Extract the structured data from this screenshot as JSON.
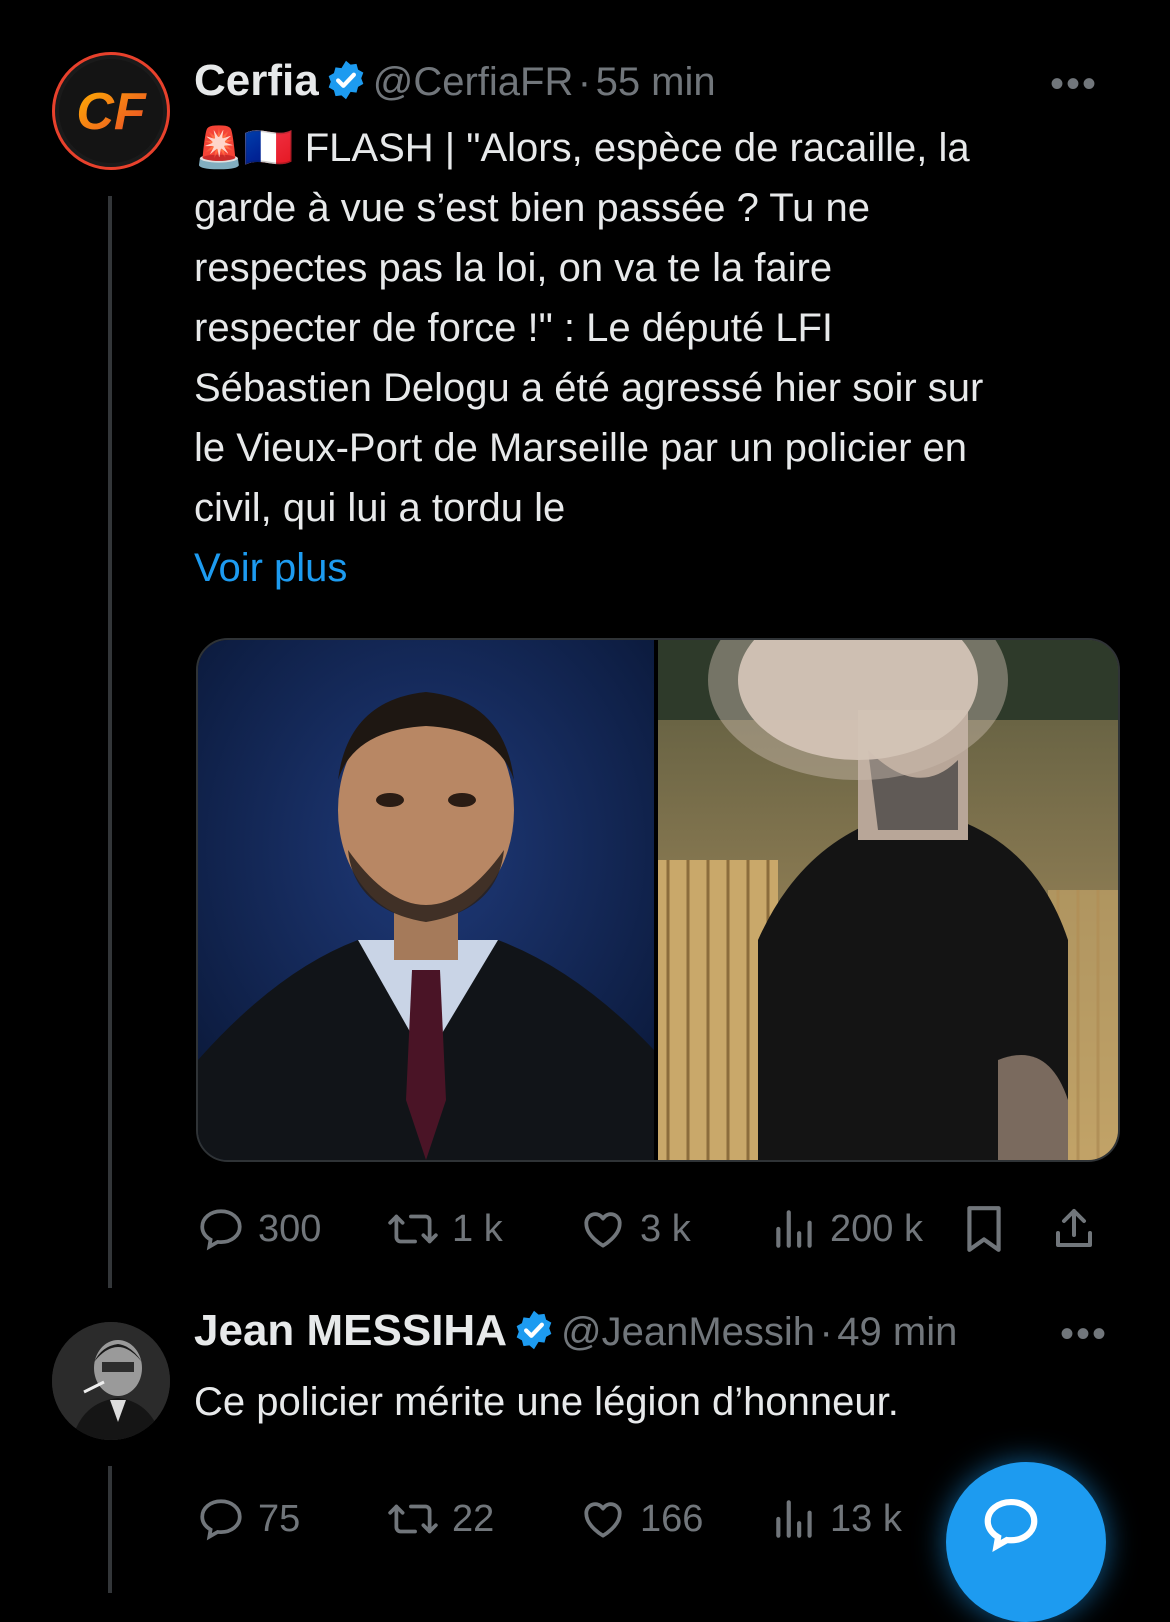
{
  "tweet": {
    "author": "Cerfia",
    "handle": "@CerfiaFR",
    "sep": "·",
    "time": "55 min",
    "lines": [
      "FLASH | \"Alors, espèce de racaille, la",
      "garde à vue s’est bien passée ? Tu ne",
      "respectes pas la loi, on va te la faire",
      "respecter de force !\" : Le député LFI",
      "Sébastien Delogu a été agressé hier soir sur",
      "le Vieux-Port de Marseille par un policier en",
      "civil, qui lui a tordu le"
    ],
    "prefix_emoji": "🚨🇫🇷",
    "see_more": "Voir plus",
    "avatar_text": "CF",
    "stats": {
      "replies": "300",
      "retweets": "1 k",
      "likes": "3 k",
      "views": "200 k"
    }
  },
  "reply": {
    "author": "Jean MESSIHA",
    "handle": "@JeanMessih",
    "sep": "·",
    "time": "49 min",
    "text": "Ce policier mérite une légion d’honneur.",
    "stats": {
      "replies": "75",
      "retweets": "22",
      "likes": "166",
      "views": "13 k"
    }
  },
  "colors": {
    "accent": "#1d9bf0",
    "muted": "#71767b",
    "background": "#000000"
  },
  "icons": [
    "reply-icon",
    "retweet-icon",
    "like-icon",
    "views-icon",
    "bookmark-icon",
    "share-icon",
    "verified-icon",
    "more-icon",
    "compose-reply-icon"
  ]
}
